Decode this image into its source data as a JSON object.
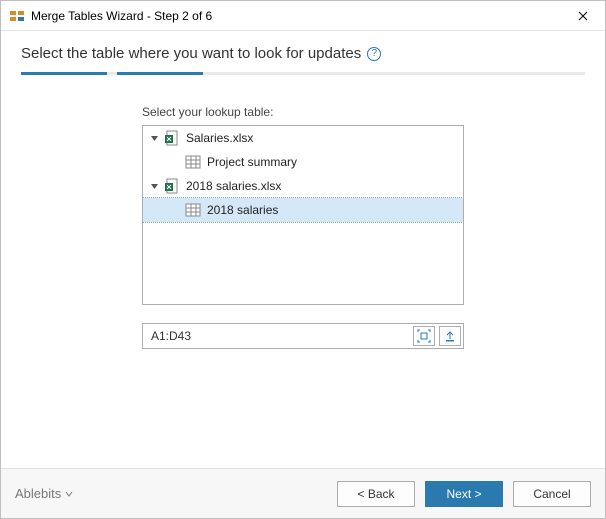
{
  "window": {
    "title": "Merge Tables Wizard - Step 2 of 6"
  },
  "instruction": "Select the table where you want to look for updates",
  "inner_label": "Select your lookup table:",
  "tree": {
    "items": [
      {
        "kind": "workbook",
        "label": "Salaries.xlsx",
        "expanded": true
      },
      {
        "kind": "sheet",
        "label": "Project summary",
        "parent": 0
      },
      {
        "kind": "workbook",
        "label": "2018 salaries.xlsx",
        "expanded": true
      },
      {
        "kind": "sheet",
        "label": "2018 salaries",
        "parent": 2,
        "selected": true
      }
    ]
  },
  "range": {
    "value": "A1:D43"
  },
  "footer": {
    "brand": "Ablebits",
    "back": "< Back",
    "next": "Next >",
    "cancel": "Cancel"
  },
  "colors": {
    "accent": "#2a7ab0",
    "selection": "#d5e8f7"
  }
}
